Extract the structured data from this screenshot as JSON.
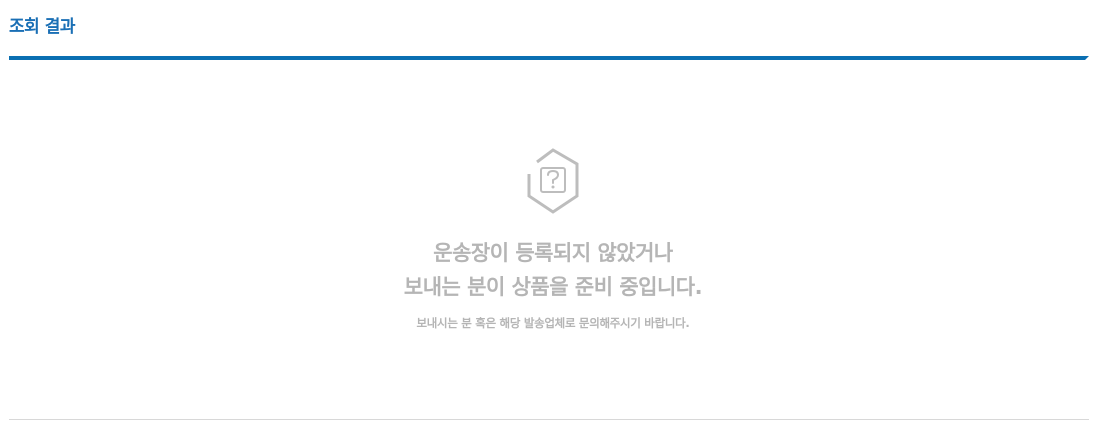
{
  "header": {
    "title": "조회 결과"
  },
  "empty_state": {
    "icon": "question-hexagon-icon",
    "message_line1": "운송장이 등록되지 않았거나",
    "message_line2": "보내는 분이 상품을 준비 중입니다.",
    "sub_message": "보내시는 분 혹은 해당 발송업체로 문의해주시기 바랍니다."
  },
  "colors": {
    "accent": "#0a6fb2",
    "title_text": "#1a6fb5",
    "muted_text": "#b5b5b5",
    "divider": "#d8d8d8"
  }
}
